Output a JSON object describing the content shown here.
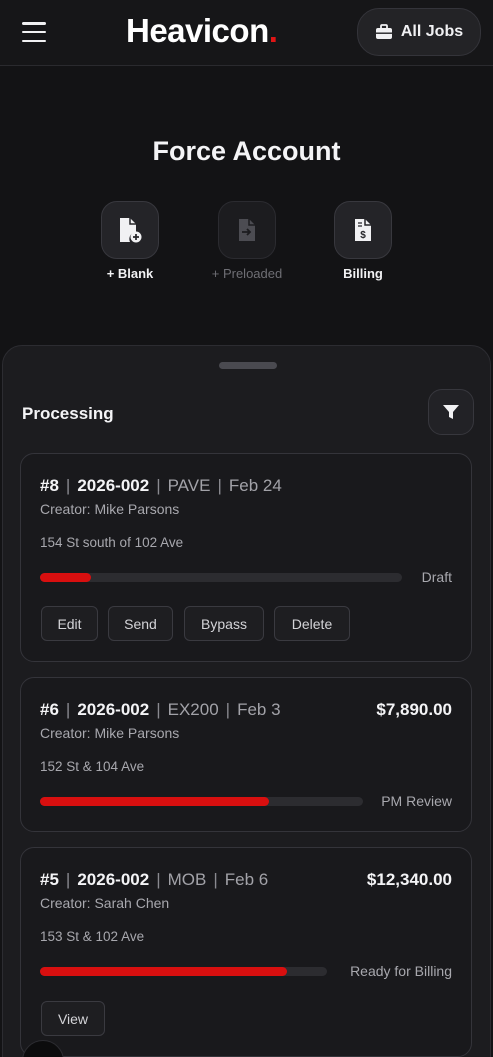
{
  "header": {
    "menu_icon": "hamburger-icon",
    "logo_text": "Heavicon",
    "logo_dot": ".",
    "all_jobs_label": "All Jobs",
    "all_jobs_icon": "briefcase-icon",
    "accent": "#e01515"
  },
  "page": {
    "title": "Force Account"
  },
  "actions": [
    {
      "label": "+ Blank",
      "icon": "file-plus-icon",
      "enabled": true
    },
    {
      "label": "+ Preloaded",
      "icon": "file-import-icon",
      "enabled": false
    },
    {
      "label": "Billing",
      "icon": "invoice-dollar-icon",
      "enabled": true
    }
  ],
  "sheet": {
    "section_title": "Processing",
    "filter_icon": "filter-icon"
  },
  "cards": [
    {
      "number": "#8",
      "code": "2026-002",
      "type": "PAVE",
      "date": "Feb 24",
      "amount": "",
      "creator": "Creator: Mike Parsons",
      "location": "154 St south of 102 Ave",
      "progress": 0.14,
      "status": "Draft",
      "buttons": [
        "Edit",
        "Send",
        "Bypass",
        "Delete"
      ]
    },
    {
      "number": "#6",
      "code": "2026-002",
      "type": "EX200",
      "date": "Feb 3",
      "amount": "$7,890.00",
      "creator": "Creator: Mike Parsons",
      "location": "152 St & 104 Ave",
      "progress": 0.71,
      "status": "PM Review",
      "buttons": []
    },
    {
      "number": "#5",
      "code": "2026-002",
      "type": "MOB",
      "date": "Feb 6",
      "amount": "$12,340.00",
      "creator": "Creator: Sarah Chen",
      "location": "153 St & 102 Ave",
      "progress": 0.86,
      "status": "Ready for Billing",
      "buttons": [
        "View"
      ]
    }
  ],
  "colors": {
    "progress_fill": "#d80f0f",
    "progress_track": "#2c2c30",
    "background": "#131315"
  }
}
